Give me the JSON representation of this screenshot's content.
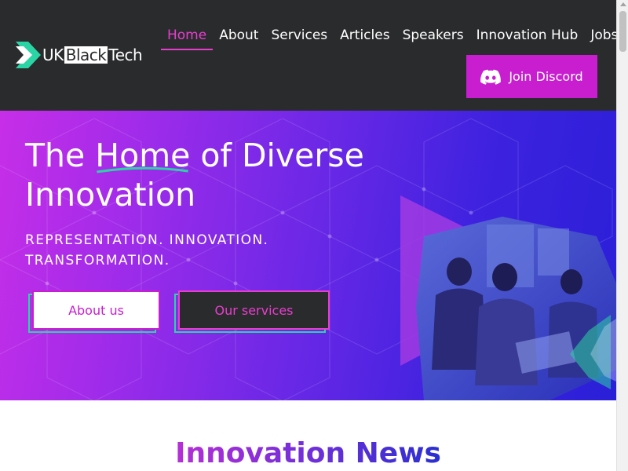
{
  "brand": {
    "logo_uk": "UK",
    "logo_black": "Black",
    "logo_tech": "Tech",
    "logo_icon": "chevron-logo-icon"
  },
  "nav": {
    "items": [
      {
        "label": "Home",
        "active": true
      },
      {
        "label": "About",
        "active": false
      },
      {
        "label": "Services",
        "active": false
      },
      {
        "label": "Articles",
        "active": false
      },
      {
        "label": "Speakers",
        "active": false
      },
      {
        "label": "Innovation Hub",
        "active": false
      },
      {
        "label": "Jobs",
        "active": false
      }
    ],
    "discord_label": "Join Discord",
    "discord_icon": "discord-icon"
  },
  "hero": {
    "title_before": "The ",
    "title_highlight": "Home",
    "title_after": " of Diverse Innovation",
    "tagline": "REPRESENTATION. INNOVATION. TRANSFORMATION.",
    "about_button": "About us",
    "services_button": "Our services"
  },
  "news": {
    "title": "Innovation News"
  },
  "colors": {
    "header_bg": "#2a2b2d",
    "accent_magenta": "#c81ed0",
    "nav_active": "#e83ecf",
    "accent_green": "#2bd4a4",
    "hero_start": "#c72ee8",
    "hero_end": "#2a1fd8"
  }
}
